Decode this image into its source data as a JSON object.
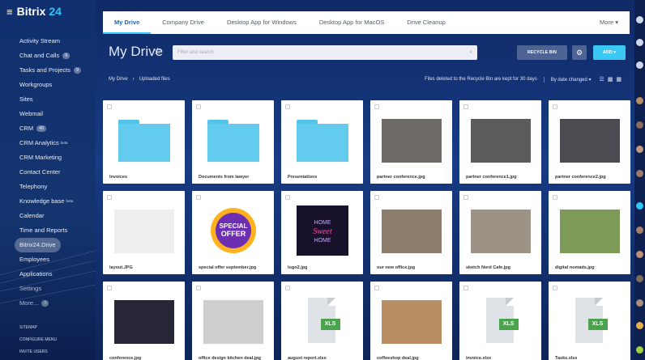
{
  "brand": {
    "name": "Bitrix",
    "num": "24"
  },
  "sidebar": {
    "items": [
      {
        "label": "Activity Stream",
        "badge": "",
        "sup": ""
      },
      {
        "label": "Chat and Calls",
        "badge": "9",
        "sup": ""
      },
      {
        "label": "Tasks and Projects",
        "badge": "9",
        "sup": ""
      },
      {
        "label": "Workgroups",
        "badge": "",
        "sup": ""
      },
      {
        "label": "Sites",
        "badge": "",
        "sup": ""
      },
      {
        "label": "Webmail",
        "badge": "",
        "sup": ""
      },
      {
        "label": "CRM",
        "badge": "40",
        "sup": ""
      },
      {
        "label": "CRM Analytics",
        "badge": "",
        "sup": "beta"
      },
      {
        "label": "CRM Marketing",
        "badge": "",
        "sup": ""
      },
      {
        "label": "Contact Center",
        "badge": "",
        "sup": ""
      },
      {
        "label": "Telephony",
        "badge": "",
        "sup": ""
      },
      {
        "label": "Knowledge base",
        "badge": "",
        "sup": "beta"
      },
      {
        "label": "Calendar",
        "badge": "",
        "sup": ""
      },
      {
        "label": "Time and Reports",
        "badge": "",
        "sup": ""
      },
      {
        "label": "Bitrix24.Drive",
        "badge": "",
        "sup": ""
      },
      {
        "label": "Employees",
        "badge": "",
        "sup": ""
      },
      {
        "label": "Applications",
        "badge": "",
        "sup": ""
      },
      {
        "label": "Settings",
        "badge": "",
        "sup": ""
      },
      {
        "label": "More...",
        "badge": "9",
        "sup": ""
      }
    ],
    "bottom": [
      "SITEMAP",
      "CONFIGURE MENU",
      "INVITE USERS"
    ]
  },
  "tabs": [
    "My Drive",
    "Company Drive",
    "Desktop App for Windows",
    "Desktop App for MacOS",
    "Drive Cleanup",
    "More"
  ],
  "title": "My Drive",
  "search_placeholder": "Filter and search",
  "buttons": {
    "recycle": "RECYCLE BIN",
    "add": "ADD"
  },
  "breadcrumb": [
    "My Drive",
    "Uploaded files"
  ],
  "recycle_note": "Files deleted to the Recycle Bin are kept for 30 days",
  "sort_label": "By date changed",
  "files": [
    {
      "name": "Invoices",
      "kind": "folder"
    },
    {
      "name": "Documents from lawyer",
      "kind": "folder"
    },
    {
      "name": "Presentations",
      "kind": "folder"
    },
    {
      "name": "partner conference.jpg",
      "kind": "photo",
      "color": "#6e6a66"
    },
    {
      "name": "partner conference1.jpg",
      "kind": "photo",
      "color": "#5c5a5a"
    },
    {
      "name": "partner conference2.jpg",
      "kind": "photo",
      "color": "#4d4b52"
    },
    {
      "name": "layout.JPG",
      "kind": "photo",
      "color": "#eeeeee"
    },
    {
      "name": "special offer september.jpg",
      "kind": "special"
    },
    {
      "name": "logo2.jpg",
      "kind": "logo"
    },
    {
      "name": "our new office.jpg",
      "kind": "photo",
      "color": "#8c7d6d"
    },
    {
      "name": "sketch Nord Cafe.jpg",
      "kind": "photo",
      "color": "#9c9286"
    },
    {
      "name": "digital nomads.jpg",
      "kind": "photo",
      "color": "#7d9a56"
    },
    {
      "name": "conference.jpg",
      "kind": "photo",
      "color": "#262636"
    },
    {
      "name": "office design kitchen deal.jpg",
      "kind": "photo",
      "color": "#cfcfcf"
    },
    {
      "name": "august report.xlsx",
      "kind": "xls",
      "tag": "XLS"
    },
    {
      "name": "coffeeshop deal.jpg",
      "kind": "photo",
      "color": "#b98e62"
    },
    {
      "name": "invoice.xlsx",
      "kind": "xls",
      "tag": "XLS"
    },
    {
      "name": "Tasks.xlsx",
      "kind": "xls",
      "tag": "XLS"
    }
  ],
  "special_text": [
    "SPECIAL",
    "OFFER"
  ],
  "logo_text": [
    "HOME",
    "Sweet",
    "HOME"
  ]
}
